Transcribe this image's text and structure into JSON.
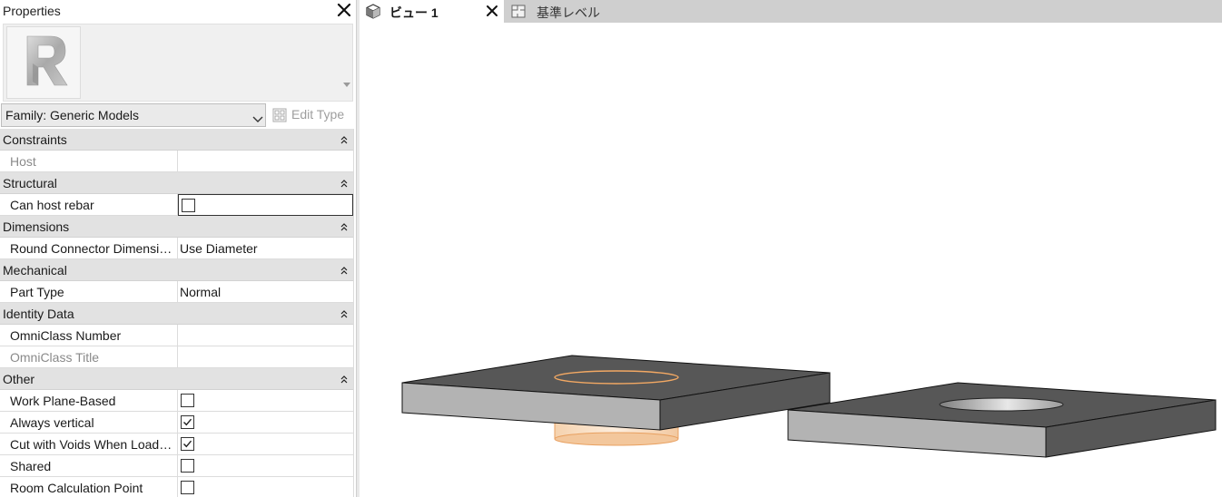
{
  "properties_panel": {
    "title": "Properties",
    "type_selector_icon": "revit-family-icon",
    "family_select": {
      "value": "Family: Generic Models"
    },
    "edit_type_label": "Edit Type",
    "groups": [
      {
        "label": "Constraints",
        "rows": [
          {
            "name": "Host",
            "value": "",
            "disabled": true
          }
        ]
      },
      {
        "label": "Structural",
        "rows": [
          {
            "name": "Can host rebar",
            "checkbox": false,
            "selected": true
          }
        ]
      },
      {
        "label": "Dimensions",
        "rows": [
          {
            "name": "Round Connector Dimensi…",
            "value": "Use Diameter"
          }
        ]
      },
      {
        "label": "Mechanical",
        "rows": [
          {
            "name": "Part Type",
            "value": "Normal"
          }
        ]
      },
      {
        "label": "Identity Data",
        "rows": [
          {
            "name": "OmniClass Number",
            "value": ""
          },
          {
            "name": "OmniClass Title",
            "value": "",
            "disabled": true
          }
        ]
      },
      {
        "label": "Other",
        "rows": [
          {
            "name": "Work Plane-Based",
            "checkbox": false
          },
          {
            "name": "Always vertical",
            "checkbox": true
          },
          {
            "name": "Cut with Voids When Load…",
            "checkbox": true
          },
          {
            "name": "Shared",
            "checkbox": false
          },
          {
            "name": "Room Calculation Point",
            "checkbox": false
          }
        ]
      }
    ]
  },
  "tabs": [
    {
      "label": "ビュー 1",
      "icon": "3d-view-cube-icon",
      "active": true,
      "closable": true
    },
    {
      "label": "基準レベル",
      "icon": "floor-plan-icon",
      "active": false
    }
  ],
  "viewport": {
    "description_colors": {
      "top_face": "#575757",
      "side_face": "#b3b3b3",
      "void_highlight": "#f2a863"
    }
  }
}
